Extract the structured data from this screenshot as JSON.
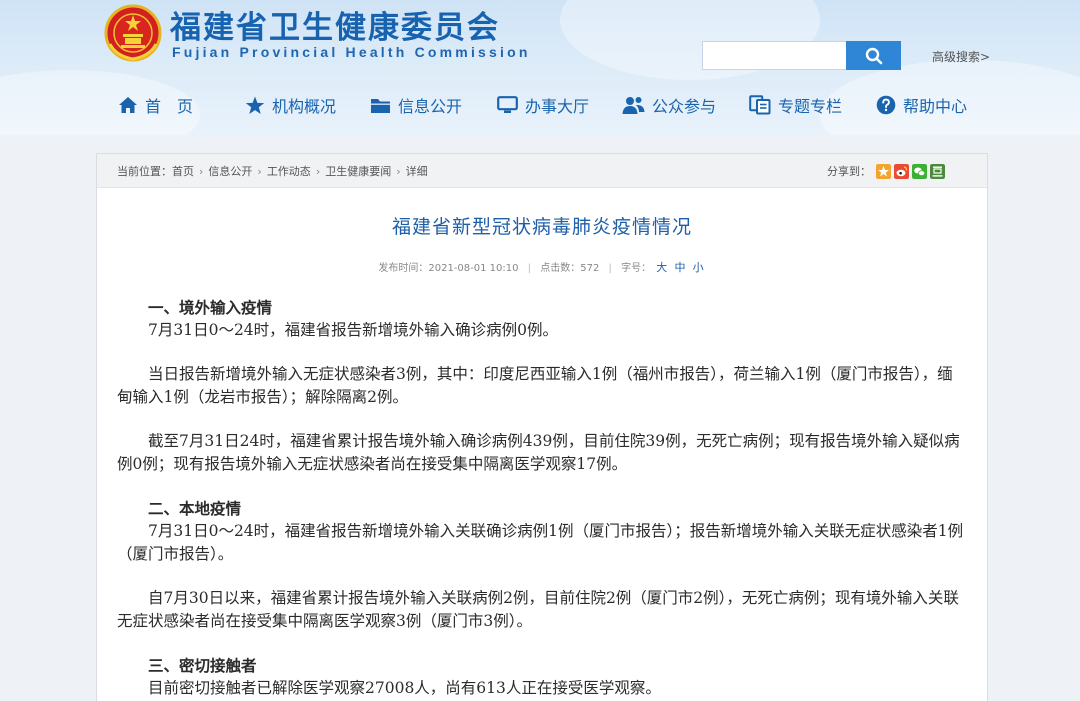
{
  "header": {
    "title_cn": "福建省卫生健康委员会",
    "title_en": "Fujian Provincial Health Commission",
    "search_placeholder": "",
    "advanced_search": "高级搜索>",
    "brand_color": "#1863b0"
  },
  "nav": {
    "items": [
      {
        "label": "首　页",
        "icon": "home-icon"
      },
      {
        "label": "机构概况",
        "icon": "star-icon"
      },
      {
        "label": "信息公开",
        "icon": "folder-icon"
      },
      {
        "label": "办事大厅",
        "icon": "monitor-icon"
      },
      {
        "label": "公众参与",
        "icon": "people-icon"
      },
      {
        "label": "专题专栏",
        "icon": "topic-icon"
      },
      {
        "label": "帮助中心",
        "icon": "help-icon"
      }
    ]
  },
  "breadcrumb": {
    "prefix": "当前位置：",
    "items": [
      "首页",
      "信息公开",
      "工作动态",
      "卫生健康要闻",
      "详细"
    ],
    "separator": "›"
  },
  "share": {
    "label": "分享到：",
    "icons": [
      "qzone-icon",
      "weibo-icon",
      "wechat-icon",
      "douban-icon"
    ]
  },
  "article": {
    "title": "福建省新型冠状病毒肺炎疫情情况",
    "publish_label": "发布时间：",
    "publish_time": "2021-08-01 10:10",
    "hits_label": "点击数：",
    "hits": "572",
    "font_label": "字号：",
    "font_sizes": [
      "大",
      "中",
      "小"
    ],
    "sections": [
      {
        "heading": "一、境外输入疫情",
        "paragraphs": [
          "7月31日0～24时，福建省报告新增境外输入确诊病例0例。",
          "当日报告新增境外输入无症状感染者3例，其中：印度尼西亚输入1例（福州市报告），荷兰输入1例（厦门市报告），缅甸输入1例（龙岩市报告）；解除隔离2例。",
          "截至7月31日24时，福建省累计报告境外输入确诊病例439例，目前住院39例，无死亡病例；现有报告境外输入疑似病例0例；现有报告境外输入无症状感染者尚在接受集中隔离医学观察17例。"
        ]
      },
      {
        "heading": "二、本地疫情",
        "paragraphs": [
          "7月31日0～24时，福建省报告新增境外输入关联确诊病例1例（厦门市报告）；报告新增境外输入关联无症状感染者1例（厦门市报告）。",
          "自7月30日以来，福建省累计报告境外输入关联病例2例，目前住院2例（厦门市2例），无死亡病例；现有境外输入关联无症状感染者尚在接受集中隔离医学观察3例（厦门市3例）。"
        ]
      },
      {
        "heading": "三、密切接触者",
        "paragraphs": [
          "目前密切接触者已解除医学观察27008人，尚有613人正在接受医学观察。"
        ]
      }
    ]
  }
}
